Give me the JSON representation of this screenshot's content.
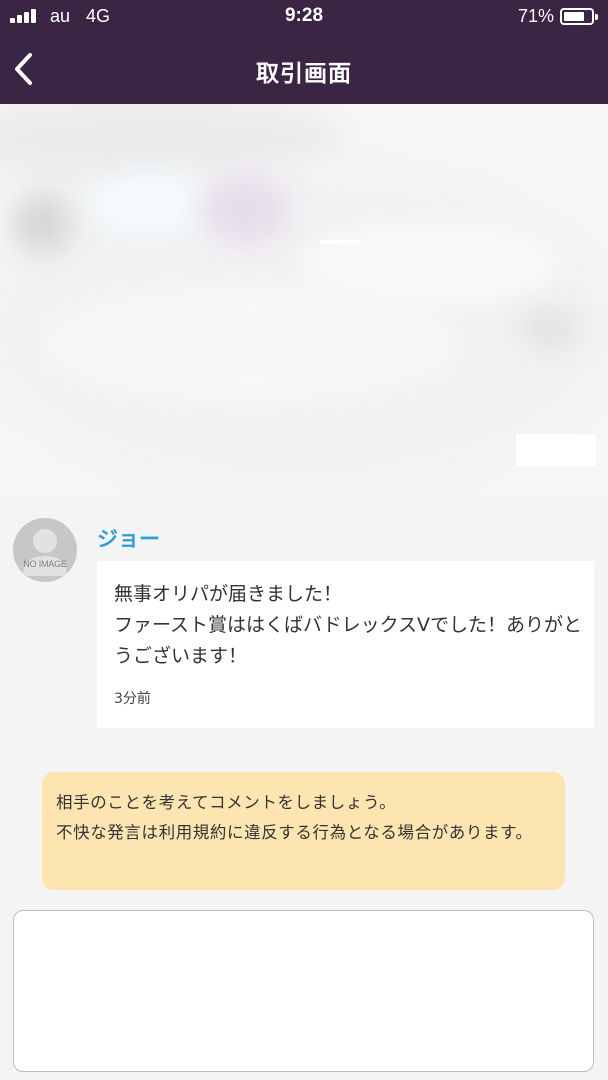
{
  "status_bar": {
    "carrier": "au",
    "network": "4G",
    "time": "9:28",
    "battery_percent": "71%",
    "battery_level": 0.71,
    "icons": [
      "signal-bars-icon",
      "battery-icon"
    ]
  },
  "nav": {
    "title": "取引画面",
    "back_icon": "chevron-left-icon"
  },
  "message": {
    "sender": "ジョー",
    "avatar_text": "NO IMAGE",
    "text": "無事オリパが届きました！\nファースト賞ははくばバドレックスVでした！ありがとうございます！",
    "time": "3分前"
  },
  "notice": {
    "text": "相手のことを考えてコメントをしましょう。\n不快な発言は利用規約に違反する行為となる場合があります。"
  },
  "comment_input": {
    "value": "",
    "placeholder": ""
  },
  "colors": {
    "header_bg": "#3a2545",
    "sender_name": "#2b9fd8",
    "notice_bg": "#fde5b1",
    "page_bg": "#f4f4f4"
  }
}
